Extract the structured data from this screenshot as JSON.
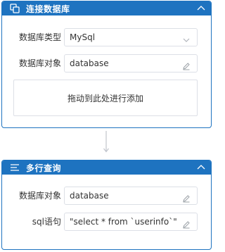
{
  "cards": [
    {
      "title": "连接数据库",
      "header_icon": "database-connect-icon",
      "fields": [
        {
          "label": "数据库类型",
          "value": "MySql",
          "control": "select",
          "icon": "chevron-down-icon"
        },
        {
          "label": "数据库对象",
          "value": "database",
          "control": "input",
          "icon": "edit-icon"
        }
      ],
      "drop_zone_text": "拖动到此处进行添加"
    },
    {
      "title": "多行查询",
      "header_icon": "list-icon",
      "fields": [
        {
          "label": "数据库对象",
          "value": "database",
          "control": "input",
          "icon": "edit-icon"
        },
        {
          "label": "sql语句",
          "value": "\"select * from `userinfo`\"",
          "control": "input",
          "icon": "edit-icon"
        }
      ]
    }
  ],
  "colors": {
    "header_bg": "#1e73c0",
    "header_text": "#ffffff",
    "border": "#dcdfe6",
    "connector": "#c0c4cc"
  }
}
